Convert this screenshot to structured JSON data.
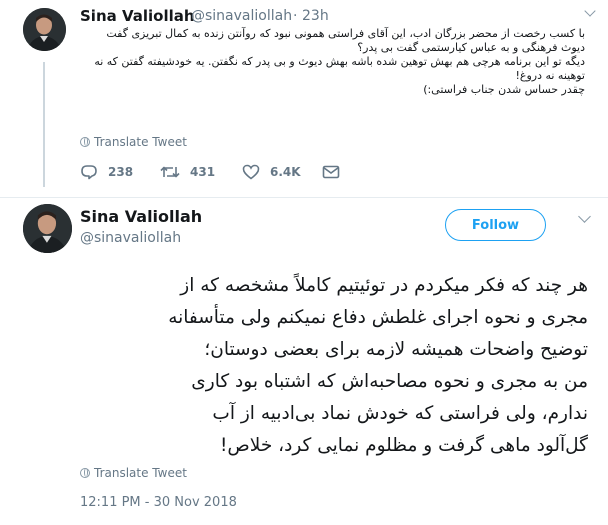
{
  "tweet1": {
    "author_name": "Sina Valiollah",
    "handle": "@sinavaliollah",
    "separator": "·",
    "time": "23h",
    "lines": [
      "با کسب رخصت از محضر بزرگان ادب، این آقای فراستی همونی نبود که روآنتن زنده به کمال تبریزی گفت",
      "دیوث فرهنگی و به عباس کیارستمی گفت بی پدر؟",
      "دیگه تو این برنامه هرچی هم بهش توهین شده باشه بهش دیوث و بی پدر که نگفتن. یه خودشیفته گفتن که نه",
      "توهینه نه دروغ!",
      "چقدر حساس شدن جناب فراستی:)"
    ],
    "translate_label": "Translate Tweet",
    "replies": "238",
    "retweets": "431",
    "likes": "6.4K"
  },
  "tweet2": {
    "author_name": "Sina Valiollah",
    "handle": "@sinavaliollah",
    "follow_label": "Follow",
    "lines": [
      "هر چند که فکر میکردم در توئیتیم کاملاً مشخصه که از",
      "مجری و نحوه اجرای غلطش دفاع نمیکنم ولی متأسفانه",
      "توضیح واضحات همیشه لازمه برای بعضی دوستان؛",
      "من به مجری و نحوه مصاحبه‌اش که اشتباه بود کاری",
      "ندارم، ولی فراستی که خودش نماد بی‌ادبیه از آب",
      "گل‌آلود ماهی گرفت و مظلوم نمایی کرد، خلاص!"
    ],
    "translate_label": "Translate Tweet",
    "timestamp": "12:11 PM - 30 Nov 2018"
  }
}
